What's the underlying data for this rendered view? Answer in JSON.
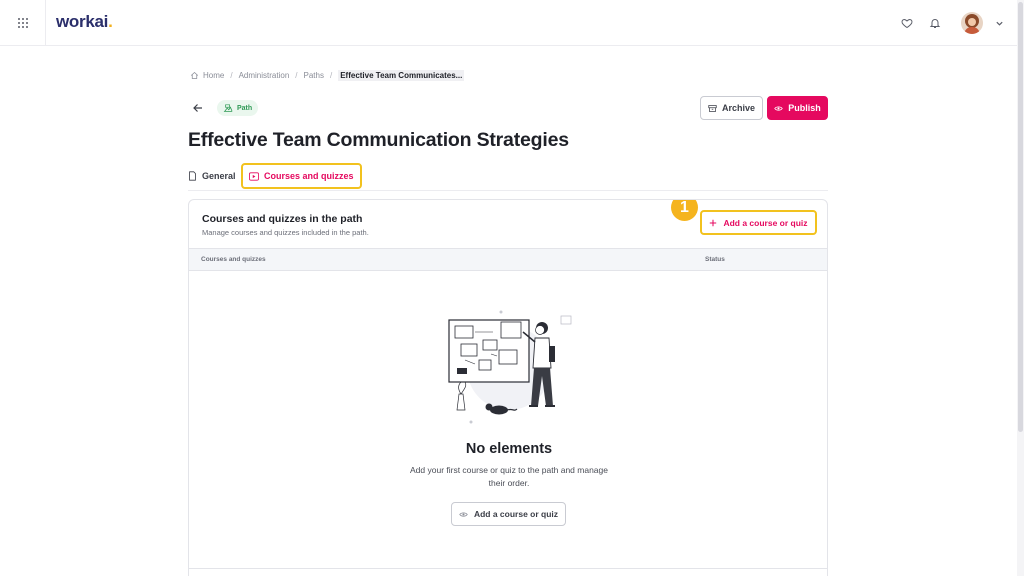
{
  "brand": {
    "name": "workai",
    "dot": "."
  },
  "breadcrumb": {
    "items": [
      "Home",
      "Administration",
      "Paths"
    ],
    "separator": "/",
    "current": "Effective Team Communicates..."
  },
  "header": {
    "badge_label": "Path",
    "archive_label": "Archive",
    "publish_label": "Publish",
    "title": "Effective Team Communication Strategies"
  },
  "tabs": [
    {
      "label": "General",
      "active": false
    },
    {
      "label": "Courses and quizzes",
      "active": true
    }
  ],
  "card": {
    "title": "Courses and quizzes in the path",
    "subtitle": "Manage courses and quizzes included in the path.",
    "step_number": "1",
    "add_button_label": "Add a course or quiz",
    "columns": [
      "Courses and quizzes",
      "Status"
    ],
    "empty": {
      "title": "No elements",
      "text": "Add your first course or quiz to the path and manage their order.",
      "button_label": "Add a course or quiz"
    }
  },
  "colors": {
    "accent": "#e5095f",
    "highlight": "#f2c21e",
    "brand": "#2b2f6b",
    "badge_green": "#2e9a55"
  },
  "icons": [
    "app-grid-icon",
    "heart-icon",
    "bell-icon",
    "chevron-down-icon",
    "home-icon",
    "back-arrow-icon",
    "path-icon",
    "archive-icon",
    "publish-icon",
    "document-icon",
    "play-icon",
    "plus-icon"
  ]
}
